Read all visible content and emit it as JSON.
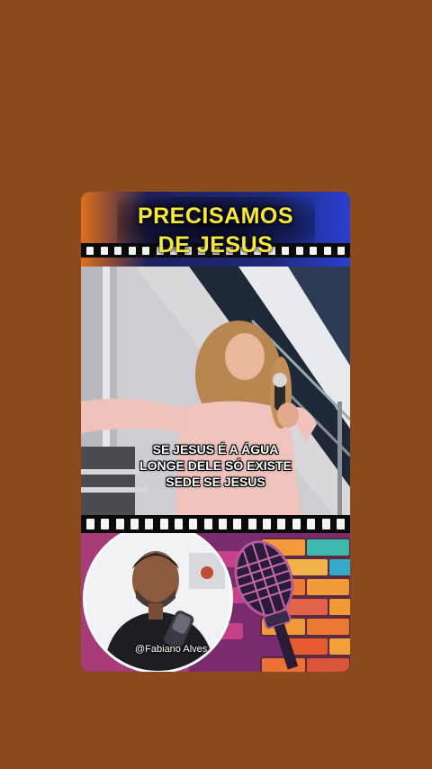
{
  "title": {
    "line1": "PRECISAMOS",
    "line2": "DE JESUS"
  },
  "caption": {
    "line1": "SE JESUS É A ÁGUA",
    "line2": "LONGE DELE SÓ EXISTE",
    "line3": "SEDE SE JESUS"
  },
  "creator": {
    "handle": "@Fabiano Alves"
  },
  "icons": [
    "film-strip-icon",
    "microphone-icon"
  ],
  "colors": {
    "background": "#8a4a1d",
    "title_text": "#f7e83a",
    "caption_text": "#ffffff"
  }
}
